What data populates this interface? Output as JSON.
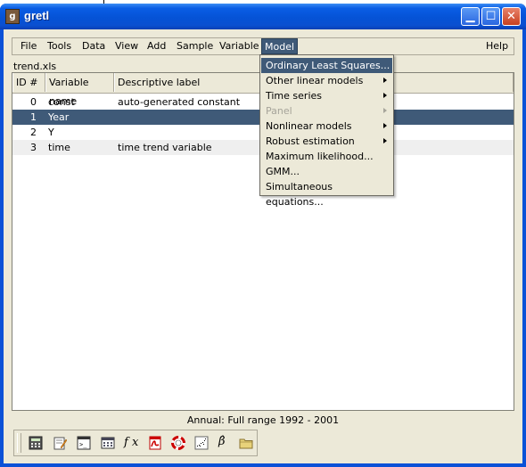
{
  "window": {
    "title": "gretl"
  },
  "menubar": {
    "items": [
      {
        "label": "File"
      },
      {
        "label": "Tools"
      },
      {
        "label": "Data"
      },
      {
        "label": "View"
      },
      {
        "label": "Add"
      },
      {
        "label": "Sample"
      },
      {
        "label": "Variable"
      },
      {
        "label": "Model"
      },
      {
        "label": "Help"
      }
    ]
  },
  "filename": "trend.xls",
  "table": {
    "headers": [
      "ID #",
      "Variable name",
      "Descriptive label"
    ],
    "rows": [
      {
        "id": "0",
        "name": "const",
        "label": "auto-generated constant"
      },
      {
        "id": "1",
        "name": "Year",
        "label": ""
      },
      {
        "id": "2",
        "name": "Y",
        "label": ""
      },
      {
        "id": "3",
        "name": "time",
        "label": "time trend variable"
      }
    ],
    "selected_row": 1
  },
  "model_menu": {
    "items": [
      {
        "label": "Ordinary Least Squares...",
        "highlighted": true
      },
      {
        "label": "Other linear models",
        "submenu": true
      },
      {
        "label": "Time series",
        "submenu": true
      },
      {
        "label": "Panel",
        "submenu": true,
        "disabled": true
      },
      {
        "label": "Nonlinear models",
        "submenu": true
      },
      {
        "label": "Robust estimation",
        "submenu": true
      },
      {
        "label": "Maximum likelihood..."
      },
      {
        "label": "GMM..."
      },
      {
        "label": "Simultaneous equations..."
      }
    ]
  },
  "status": "Annual: Full range 1992 - 2001",
  "toolbar": {
    "icons": [
      "calculator-icon",
      "edit-icon",
      "terminal-icon",
      "data-grid-icon",
      "function-icon",
      "pdf-icon",
      "help-lifebuoy-icon",
      "scatter-plot-icon",
      "beta-hat-icon",
      "folder-icon"
    ],
    "fx_label": "f x",
    "beta_label": "β̂"
  },
  "colors": {
    "titlebar": "#0553d6",
    "selection": "#3f5a78",
    "face": "#ece9d8"
  }
}
